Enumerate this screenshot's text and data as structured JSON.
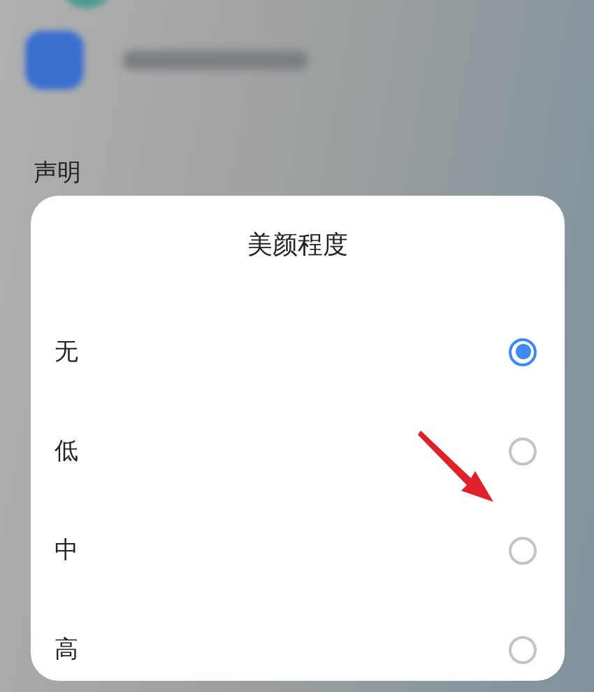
{
  "background": {
    "section_heading": "声明"
  },
  "dialog": {
    "title": "美颜程度",
    "options": [
      {
        "label": "无",
        "selected": true
      },
      {
        "label": "低",
        "selected": false
      },
      {
        "label": "中",
        "selected": false
      },
      {
        "label": "高",
        "selected": false
      }
    ]
  }
}
